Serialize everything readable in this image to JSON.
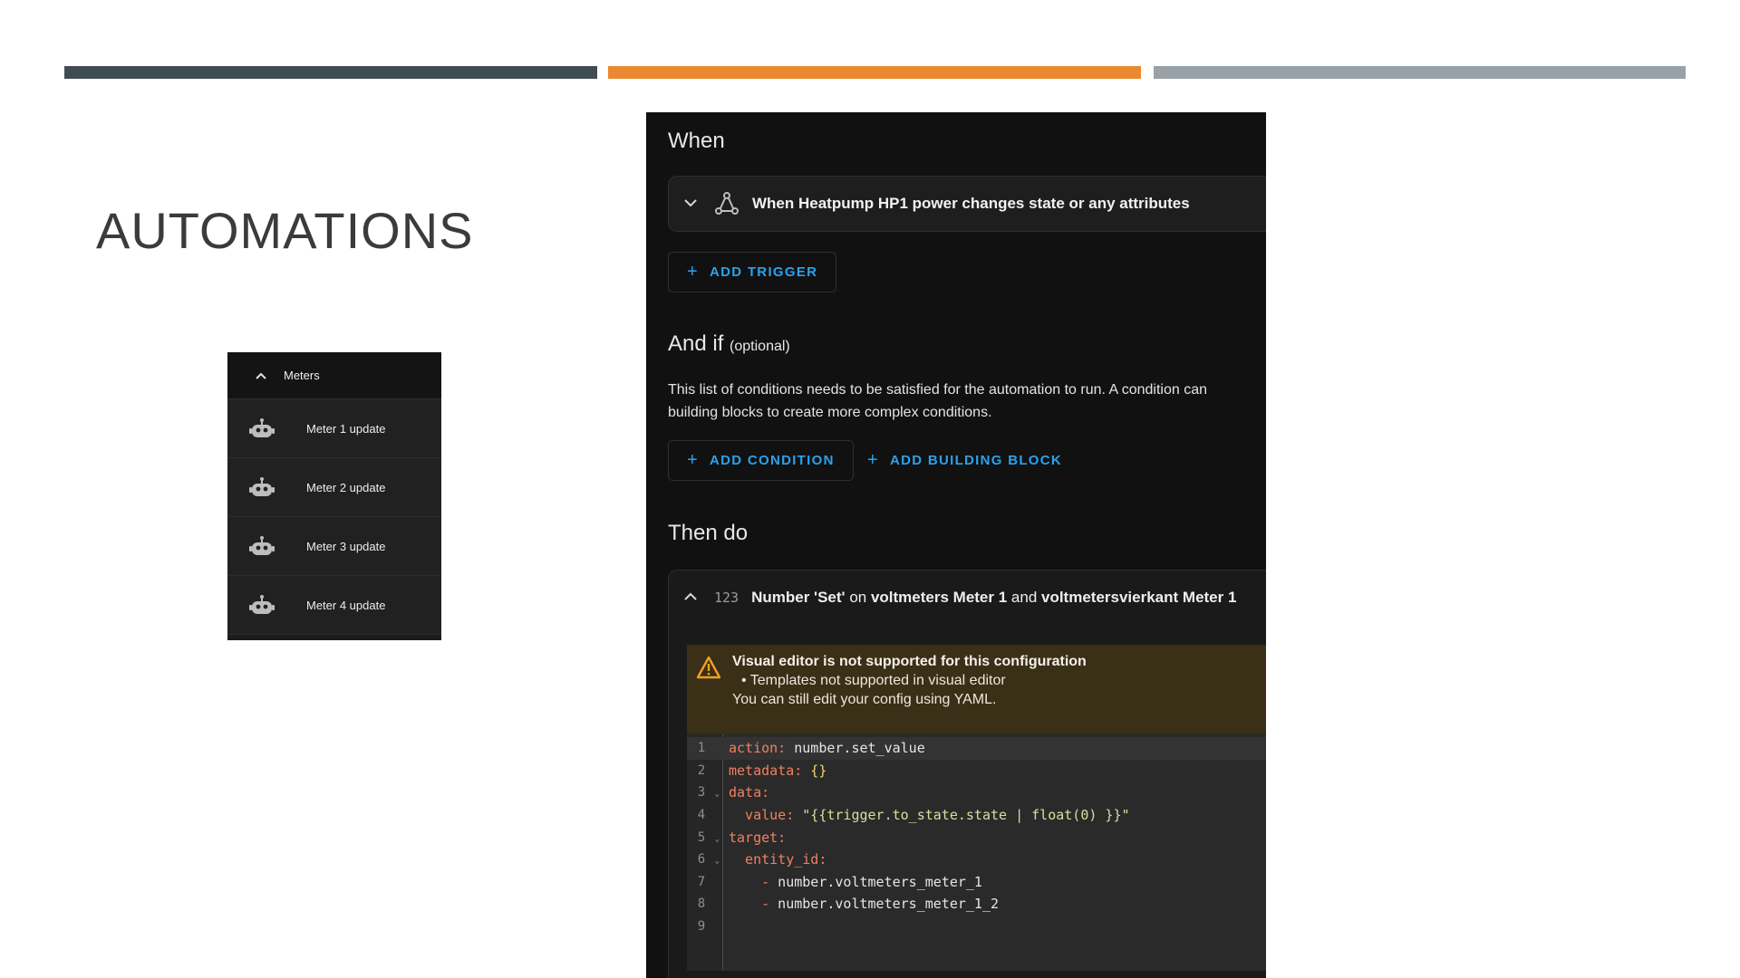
{
  "slide": {
    "title": "AUTOMATIONS",
    "colors": {
      "bar1": "#3f4c52",
      "bar2": "#ea8930",
      "bar3": "#98a1a7"
    }
  },
  "meters": {
    "header": "Meters",
    "items": [
      {
        "label": "Meter 1 update",
        "icon": "robot-icon"
      },
      {
        "label": "Meter 2 update",
        "icon": "robot-icon"
      },
      {
        "label": "Meter 3 update",
        "icon": "robot-icon"
      },
      {
        "label": "Meter 4 update",
        "icon": "robot-icon"
      }
    ]
  },
  "editor": {
    "when_title": "When",
    "trigger_text": "When Heatpump HP1 power changes state or any attributes",
    "add_trigger": "ADD TRIGGER",
    "andif_title": "And if",
    "andif_optional": "(optional)",
    "condition_desc_1": "This list of conditions needs to be satisfied for the automation to run. A condition can",
    "condition_desc_2": "building blocks to create more complex conditions.",
    "add_condition": "ADD CONDITION",
    "add_building_block": "ADD BUILDING BLOCK",
    "thendo_title": "Then do",
    "action": {
      "icon_text": "123",
      "part1": "Number 'Set'",
      "part2": " on ",
      "part3": "voltmeters Meter 1",
      "part4": " and ",
      "part5": "voltmetersvierkant Meter 1"
    },
    "warning": {
      "title": "Visual editor is not supported for this configuration",
      "bullet": "Templates not supported in visual editor",
      "note": "You can still edit your config using YAML."
    },
    "code_lines": [
      {
        "n": "1",
        "key": "action:",
        "val": " number.set_value"
      },
      {
        "n": "2",
        "key": "metadata:",
        "val": " {}"
      },
      {
        "n": "3",
        "key": "data:",
        "val": ""
      },
      {
        "n": "4",
        "key": "  value:",
        "val": " \"{{trigger.to_state.state | float(0) }}\""
      },
      {
        "n": "5",
        "key": "target:",
        "val": ""
      },
      {
        "n": "6",
        "key": "  entity_id:",
        "val": ""
      },
      {
        "n": "7",
        "key": "    -",
        "val": " number.voltmeters_meter_1"
      },
      {
        "n": "8",
        "key": "    -",
        "val": " number.voltmeters_meter_1_2"
      },
      {
        "n": "9",
        "key": "",
        "val": ""
      }
    ],
    "accent": "#2aa2ee",
    "warning_bg": "#3a2f17"
  }
}
